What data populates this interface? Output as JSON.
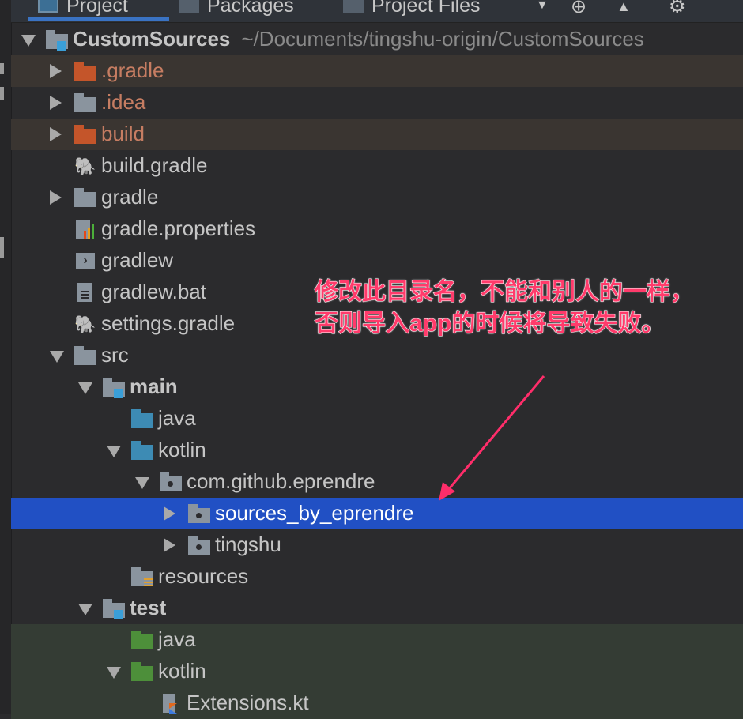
{
  "tabs": [
    {
      "label": "Project",
      "active": true
    },
    {
      "label": "Packages"
    },
    {
      "label": "Project Files"
    }
  ],
  "toolbar_icons": [
    "dropdown-icon",
    "locate-icon",
    "collapse-icon",
    "gear-icon"
  ],
  "tree": [
    {
      "label": "CustomSources",
      "path": "~/Documents/tingshu-origin/CustomSources",
      "level": 0,
      "state": "e",
      "icon": "module",
      "bold": true
    },
    {
      "label": ".gradle",
      "level": 1,
      "state": "c",
      "icon": "folder-excluded",
      "color": "#c67d62",
      "bg": "#3a3531"
    },
    {
      "label": ".idea",
      "level": 1,
      "state": "c",
      "icon": "folder",
      "color": "#c67d62"
    },
    {
      "label": "build",
      "level": 1,
      "state": "c",
      "icon": "folder-excluded",
      "color": "#c67d62",
      "bg": "#3a3531"
    },
    {
      "label": "build.gradle",
      "level": 1,
      "icon": "gradle"
    },
    {
      "label": "gradle",
      "level": 1,
      "state": "c",
      "icon": "folder"
    },
    {
      "label": "gradle.properties",
      "level": 1,
      "icon": "properties"
    },
    {
      "label": "gradlew",
      "level": 1,
      "icon": "shell"
    },
    {
      "label": "gradlew.bat",
      "level": 1,
      "icon": "text-file"
    },
    {
      "label": "settings.gradle",
      "level": 1,
      "icon": "gradle"
    },
    {
      "label": "src",
      "level": 1,
      "state": "e",
      "icon": "folder"
    },
    {
      "label": "main",
      "level": 2,
      "state": "e",
      "icon": "module",
      "bold": true
    },
    {
      "label": "java",
      "level": 3,
      "icon": "folder-source"
    },
    {
      "label": "kotlin",
      "level": 3,
      "state": "e",
      "icon": "folder-source"
    },
    {
      "label": "com.github.eprendre",
      "level": 4,
      "state": "e",
      "icon": "package"
    },
    {
      "label": "sources_by_eprendre",
      "level": 5,
      "state": "c",
      "icon": "package",
      "selected": true
    },
    {
      "label": "tingshu",
      "level": 5,
      "state": "c",
      "icon": "package"
    },
    {
      "label": "resources",
      "level": 3,
      "icon": "folder-resources"
    },
    {
      "label": "test",
      "level": 2,
      "state": "e",
      "icon": "module",
      "bold": true
    },
    {
      "label": "java",
      "level": 3,
      "icon": "folder-test",
      "bg": "#343c34"
    },
    {
      "label": "kotlin",
      "level": 3,
      "state": "e",
      "icon": "folder-test",
      "bg": "#343c34"
    },
    {
      "label": "Extensions.kt",
      "level": 4,
      "icon": "kotlin-file",
      "bg": "#343c34"
    }
  ],
  "annotation": {
    "line1": "修改此目录名，不能和别人的一样，",
    "line2": "否则导入app的时候将导致失败。",
    "color": "#ff2d6a"
  },
  "colors": {
    "selected": "#2150c4",
    "text": "#c5c5c5"
  }
}
